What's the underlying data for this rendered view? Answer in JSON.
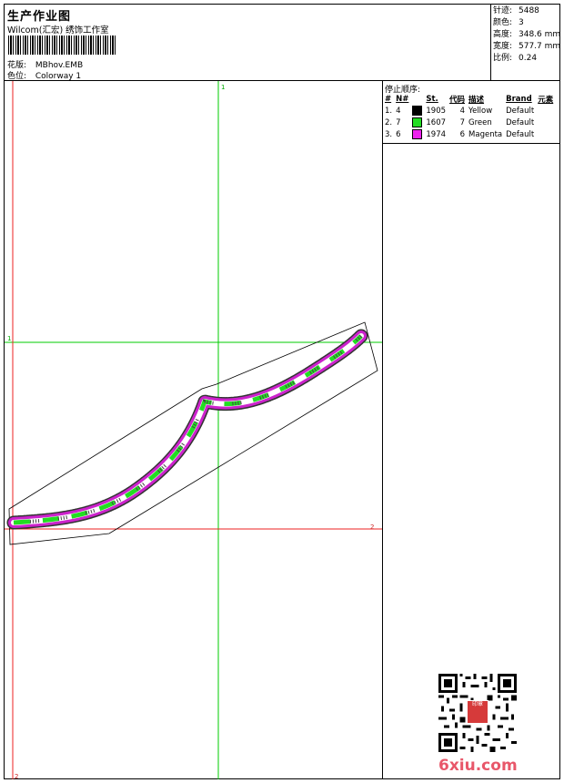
{
  "header": {
    "title": "生产作业图",
    "company": "Wilcom(汇宏) 绣饰工作室",
    "design_label": "花版:",
    "design_value": "MBhov.EMB",
    "colorway_label": "色位:",
    "colorway_value": "Colorway 1"
  },
  "stats": [
    {
      "label": "针迹:",
      "value": "5488"
    },
    {
      "label": "颜色:",
      "value": "3"
    },
    {
      "label": "高度:",
      "value": "348.6 mm"
    },
    {
      "label": "宽度:",
      "value": "577.7 mm"
    },
    {
      "label": "比例:",
      "value": "0.24"
    }
  ],
  "sequence": {
    "title": "停止顺序:",
    "columns": [
      "#",
      "N#",
      "St.",
      "代码",
      "描述",
      "Brand",
      "元素"
    ],
    "rows": [
      {
        "idx": "1.",
        "n": "4",
        "color": "#000000",
        "st": "1905",
        "code": "4",
        "desc": "Yellow",
        "brand": "Default"
      },
      {
        "idx": "2.",
        "n": "7",
        "color": "#22dd22",
        "st": "1607",
        "code": "7",
        "desc": "Green",
        "brand": "Default"
      },
      {
        "idx": "3.",
        "n": "6",
        "color": "#ee22ee",
        "st": "1974",
        "code": "6",
        "desc": "Magenta",
        "brand": "Default"
      }
    ]
  },
  "canvas_marks": {
    "top": "1",
    "left": "1",
    "right": "2",
    "bottom": "2"
  },
  "watermark": "6xiu.com",
  "seal_text": "印章",
  "colors": {
    "guide_green": "#00cc00",
    "guide_red": "#ee2222",
    "stitch_magenta": "#cc22cc",
    "stitch_green": "#22dd22"
  }
}
